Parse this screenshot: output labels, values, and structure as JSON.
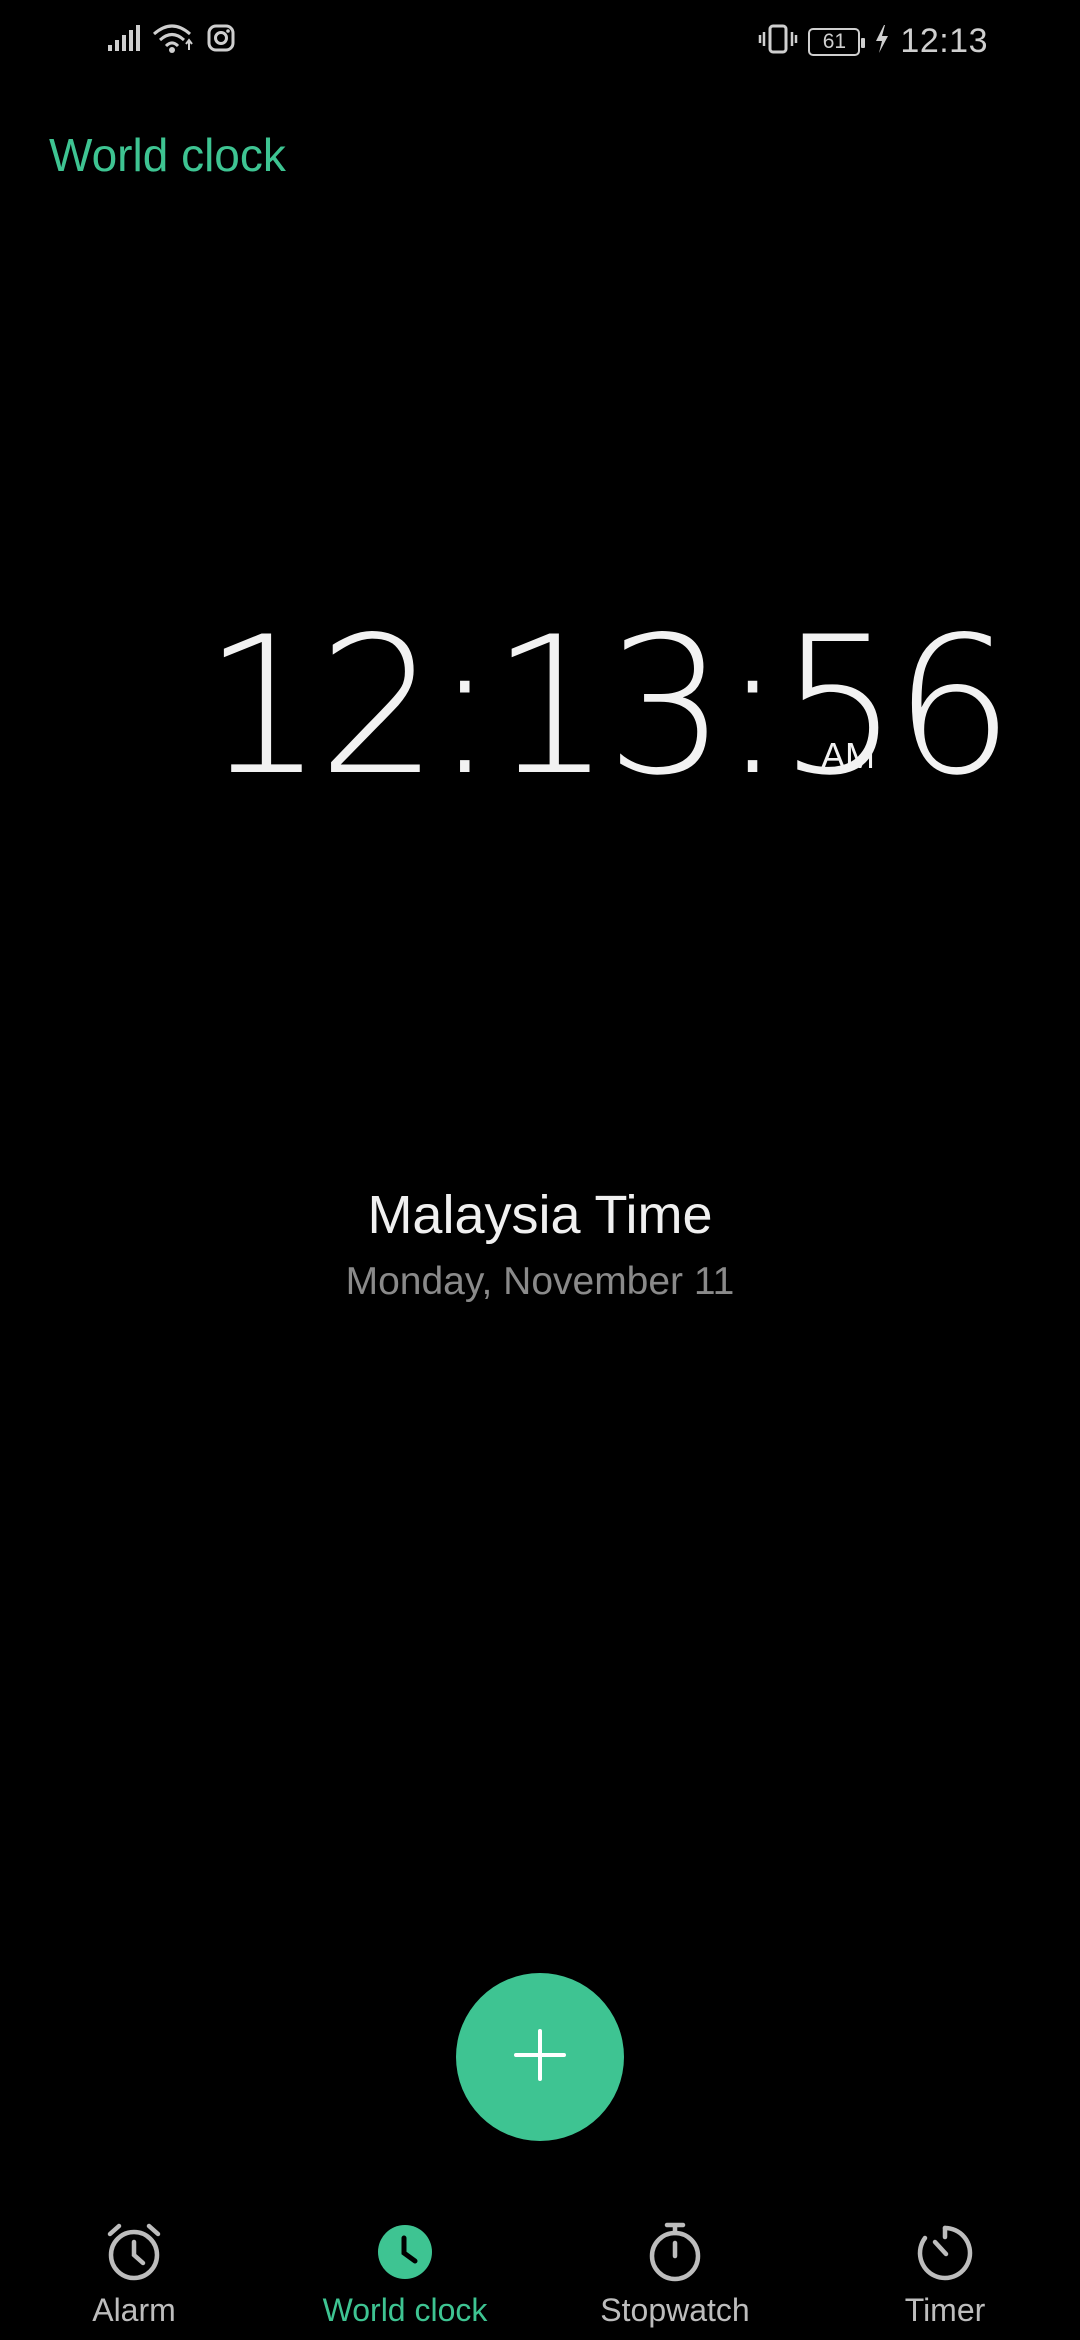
{
  "status_bar": {
    "time": "12:13",
    "battery_level": "61",
    "icons": [
      "signal-icon",
      "wifi-icon",
      "instagram-icon",
      "vibrate-icon",
      "battery-icon",
      "charging-icon"
    ]
  },
  "header": {
    "title": "World clock"
  },
  "clock": {
    "time": "12:13:56",
    "period": "AM"
  },
  "location": {
    "name": "Malaysia Time",
    "date": "Monday, November 11"
  },
  "fab": {
    "icon": "plus-icon"
  },
  "nav": {
    "items": [
      {
        "label": "Alarm",
        "icon": "alarm-icon"
      },
      {
        "label": "World clock",
        "icon": "clock-icon",
        "active": true
      },
      {
        "label": "Stopwatch",
        "icon": "stopwatch-icon"
      },
      {
        "label": "Timer",
        "icon": "timer-icon"
      }
    ]
  },
  "colors": {
    "accent": "#3ec492",
    "background": "#000000",
    "text_primary": "#f2f2f2",
    "text_secondary": "#8a8a8a"
  }
}
